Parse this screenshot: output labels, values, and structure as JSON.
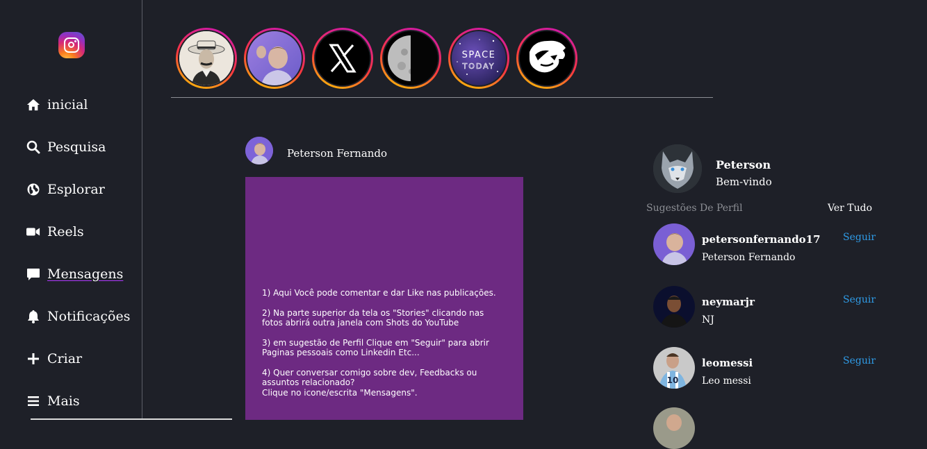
{
  "sidebar": {
    "logo_icon": "instagram-logo-icon",
    "items": [
      {
        "label": "inicial",
        "icon": "home-icon"
      },
      {
        "label": "Pesquisa",
        "icon": "search-icon"
      },
      {
        "label": "Esplorar",
        "icon": "globe-icon"
      },
      {
        "label": "Reels",
        "icon": "video-camera-icon"
      },
      {
        "label": "Mensagens",
        "icon": "message-icon"
      },
      {
        "label": "Notificações",
        "icon": "bell-icon"
      },
      {
        "label": "Criar",
        "icon": "plus-icon"
      },
      {
        "label": "Mais",
        "icon": "menu-icon"
      }
    ]
  },
  "stories": [
    {
      "name": "story-vintage-portrait"
    },
    {
      "name": "story-peterson-selfie"
    },
    {
      "name": "story-x-logo",
      "logo_text": "X"
    },
    {
      "name": "story-moon"
    },
    {
      "name": "story-space-today",
      "logo_text": "SPACE TODAY"
    },
    {
      "name": "story-furia-panther"
    }
  ],
  "post": {
    "author": "Peterson Fernando",
    "lines": [
      "1) Aqui Você pode comentar e dar Like nas publicações.",
      "2) Na parte superior da tela os \"Stories\" clicando nas fotos abrirá outra janela com Shots do YouTube",
      "3) em sugestão de Perfil Clique em \"Seguir\" para abrir Paginas pessoais como Linkedin Etc...",
      "4) Quer conversar comigo sobre dev, Feedbacks ou assuntos relacionado?",
      "Clique no icone/escrita \"Mensagens\"."
    ]
  },
  "profile": {
    "name": "Peterson",
    "greeting": "Bem-vindo"
  },
  "suggestions": {
    "title": "Sugestões De Perfil",
    "see_all": "Ver Tudo",
    "follow_label": "Seguir",
    "items": [
      {
        "username": "petersonfernando17",
        "name": "Peterson Fernando"
      },
      {
        "username": "neymarjr",
        "name": "NJ"
      },
      {
        "username": "leomessi",
        "name": "Leo messi"
      }
    ]
  },
  "colors": {
    "background": "#1e2028",
    "follow": "#2f9ce8",
    "post_card": "#6d2a82"
  }
}
